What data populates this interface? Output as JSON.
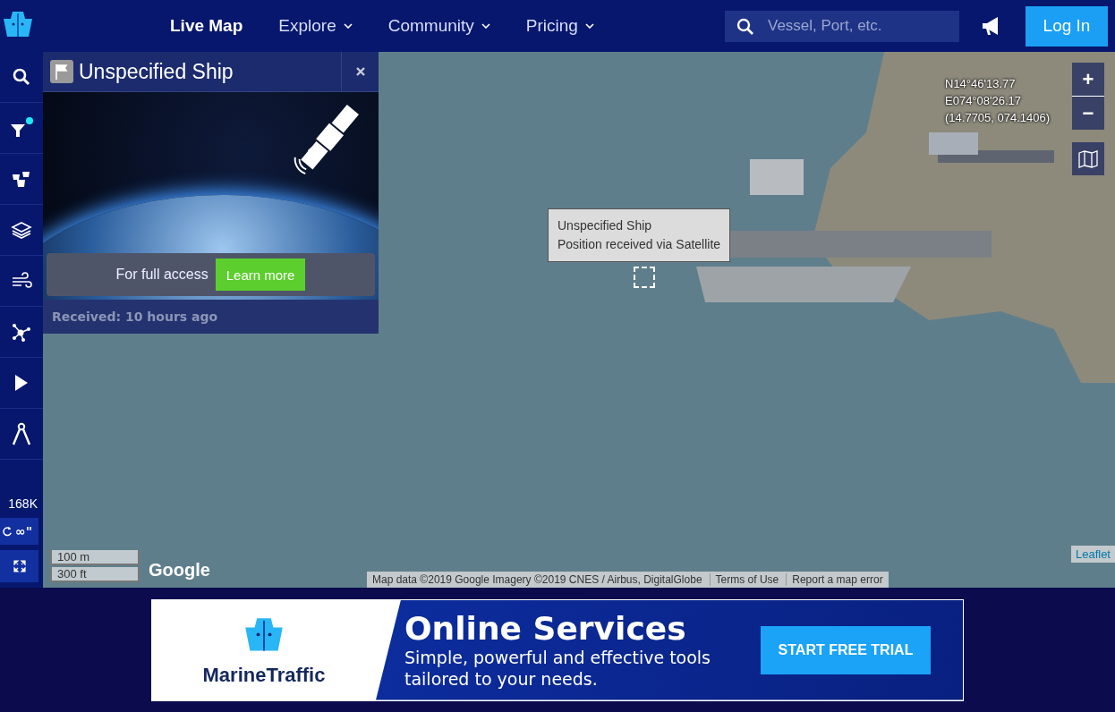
{
  "nav": {
    "items": [
      {
        "label": "Live Map",
        "selected": true,
        "dropdown": false
      },
      {
        "label": "Explore",
        "selected": false,
        "dropdown": true
      },
      {
        "label": "Community",
        "selected": false,
        "dropdown": true
      },
      {
        "label": "Pricing",
        "selected": false,
        "dropdown": true
      }
    ],
    "search": {
      "placeholder": "Vessel, Port, etc."
    },
    "login": "Log In"
  },
  "sidebar": {
    "filter_active": true,
    "vessel_count": "168K",
    "refresh": "∞\""
  },
  "popup": {
    "title": "Unspecified Ship",
    "access_text": "For full access",
    "learn_more": "Learn more",
    "received": "Received: 10 hours ago"
  },
  "tooltip": {
    "lines": [
      "Unspecified Ship",
      "Position received via Satellite"
    ]
  },
  "coordinates": [
    "N14°46'13.77",
    "E074°08'26.17",
    "(14.7705, 074.1406)"
  ],
  "zoom": {
    "in": "+",
    "out": "−"
  },
  "scale": [
    "100 m",
    "300 ft"
  ],
  "google_logo": "Google",
  "attribution": {
    "map_data": "Map data ©2019 Google Imagery ©2019 CNES / Airbus, DigitalGlobe",
    "terms": "Terms of Use",
    "report": "Report a map error",
    "leaflet": "Leaflet"
  },
  "ad": {
    "brand": "MarineTraffic",
    "headline": "Online Services",
    "subline": "Simple, powerful and effective tools tailored to your needs.",
    "cta": "START FREE TRIAL"
  }
}
